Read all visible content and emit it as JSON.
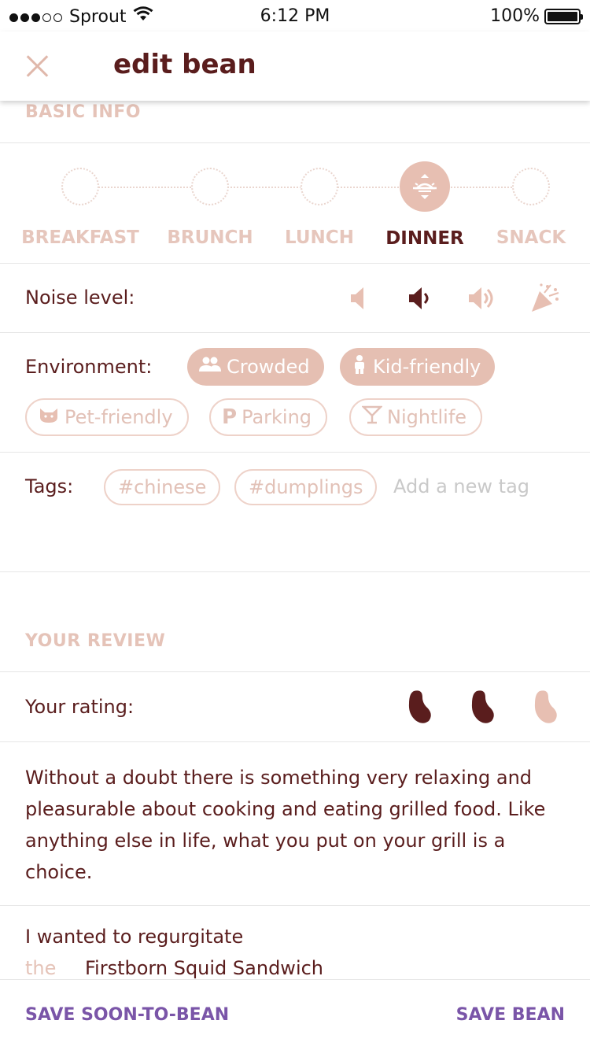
{
  "status_bar": {
    "carrier": "Sprout",
    "time": "6:12 PM",
    "battery": "100%"
  },
  "header": {
    "title": "edit bean",
    "close_icon": "close-icon"
  },
  "basic_info": {
    "heading": "BASIC INFO",
    "meals": [
      {
        "label": "BREAKFAST",
        "selected": false
      },
      {
        "label": "BRUNCH",
        "selected": false
      },
      {
        "label": "LUNCH",
        "selected": false
      },
      {
        "label": "DINNER",
        "selected": true,
        "icon": "sunset-icon"
      },
      {
        "label": "SNACK",
        "selected": false
      }
    ],
    "noise": {
      "label": "Noise level:",
      "levels": [
        {
          "icon": "volume-mute-icon",
          "selected": false
        },
        {
          "icon": "volume-low-icon",
          "selected": true
        },
        {
          "icon": "volume-high-icon",
          "selected": false
        },
        {
          "icon": "party-popper-icon",
          "selected": false
        }
      ]
    },
    "environment": {
      "label": "Environment:",
      "options": [
        {
          "label": "Crowded",
          "icon": "people-icon",
          "selected": true
        },
        {
          "label": "Kid-friendly",
          "icon": "child-icon",
          "selected": true
        },
        {
          "label": "Pet-friendly",
          "icon": "cat-icon",
          "selected": false
        },
        {
          "label": "Parking",
          "icon": "parking-icon",
          "selected": false
        },
        {
          "label": "Nightlife",
          "icon": "cocktail-icon",
          "selected": false
        }
      ]
    },
    "tags": {
      "label": "Tags:",
      "items": [
        "#chinese",
        "#dumplings"
      ],
      "placeholder": "Add a new tag"
    }
  },
  "review": {
    "heading": "YOUR REVIEW",
    "rating_label": "Your rating:",
    "rating": 2,
    "rating_max": 3,
    "text": "Without a doubt there is something very relaxing and pleasurable about cooking and eating grilled food. Like anything else in life, what you put on your grill is a choice.",
    "regurgitate_label": "I wanted to regurgitate",
    "regurgitate_article": "the",
    "regurgitate_item": "Firstborn Squid Sandwich"
  },
  "footer": {
    "save_soon_label": "SAVE SOON-TO-BEAN",
    "save_label": "SAVE BEAN"
  },
  "colors": {
    "brand_dark": "#5a1d1d",
    "accent_light": "#e5bfb2",
    "action_purple": "#7a55a8"
  }
}
